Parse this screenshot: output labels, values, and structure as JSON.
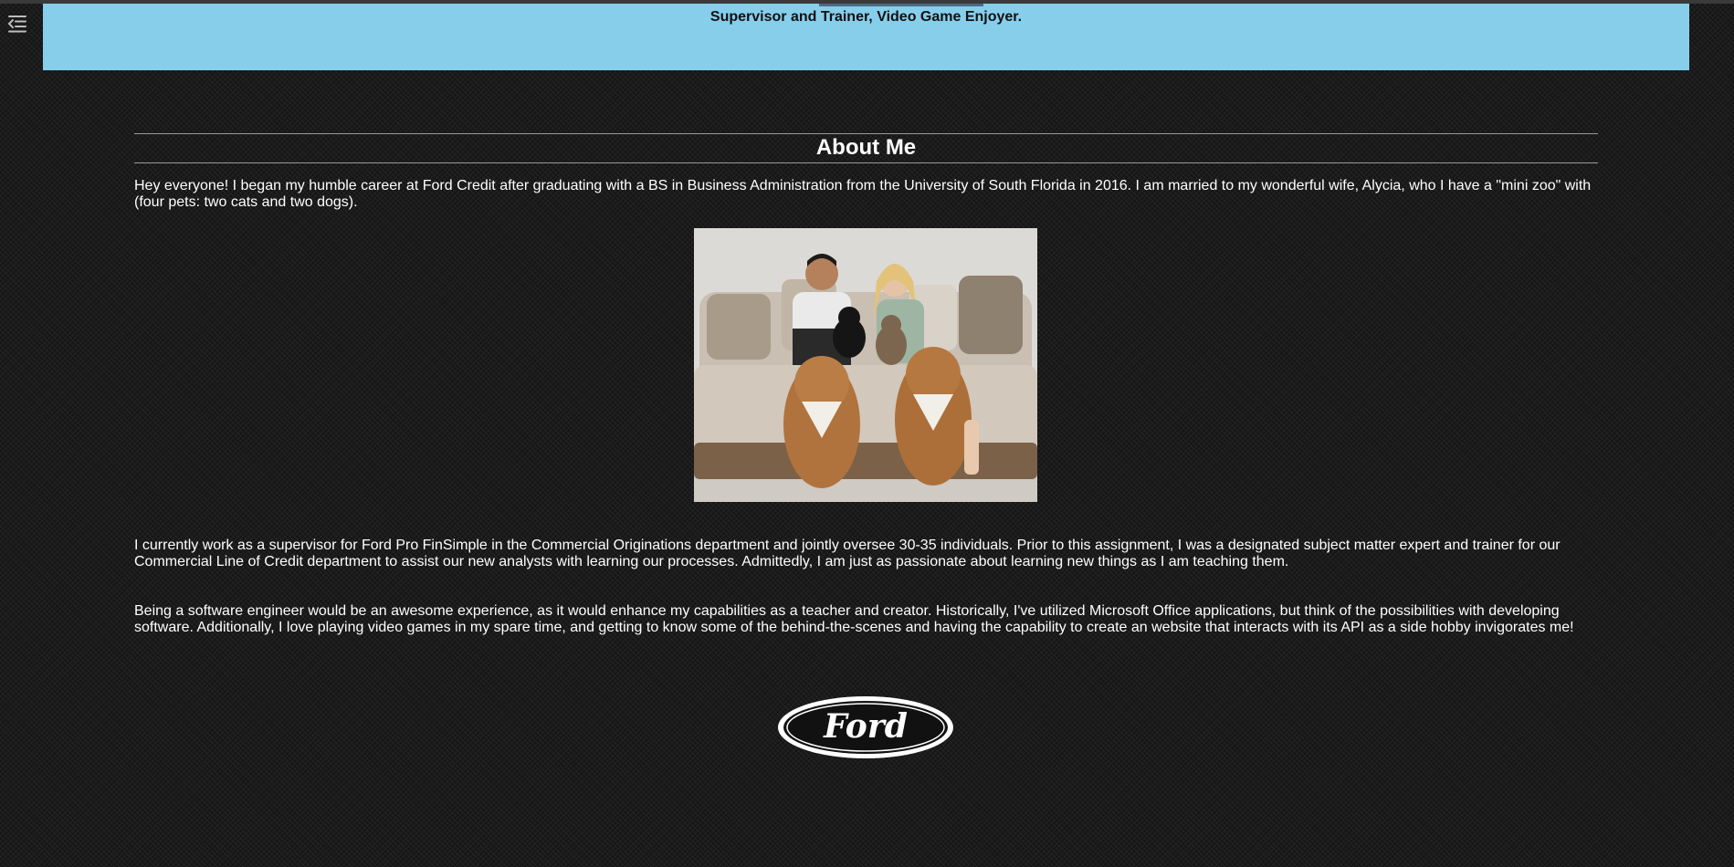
{
  "header": {
    "tagline": "Supervisor and Trainer, Video Game Enjoyer."
  },
  "sidebar_toggle": {
    "icon": "sidebar-menu-icon"
  },
  "about": {
    "title": "About Me",
    "paragraphs": [
      "Hey everyone! I began my humble career at Ford Credit after graduating with a BS in Business Administration from the University of South Florida in 2016. I am married to my wonderful wife, Alycia, who I have a \"mini zoo\" with (four pets: two cats and two dogs).",
      "I currently work as a supervisor for Ford Pro FinSimple in the Commercial Originations department and jointly oversee 30-35 individuals. Prior to this assignment, I was a designated subject matter expert and trainer for our Commercial Line of Credit department to assist our new analysts with learning our processes. Admittedly, I am just as passionate about learning new things as I am teaching them.",
      "Being a software engineer would be an awesome experience, as it would enhance my capabilities as a teacher and creator. Historically, I've utilized Microsoft Office applications, but think of the possibilities with developing software. Additionally, I love playing video games in my spare time, and getting to know some of the behind-the-scenes and having the capability to create an website that interacts with its API as a side hobby invigorates me!"
    ],
    "photo": "family-photo"
  },
  "footer": {
    "logo_text": "Ford"
  },
  "colors": {
    "banner": "#87ceeb",
    "background": "#1b1b1b",
    "text": "#ffffff"
  }
}
